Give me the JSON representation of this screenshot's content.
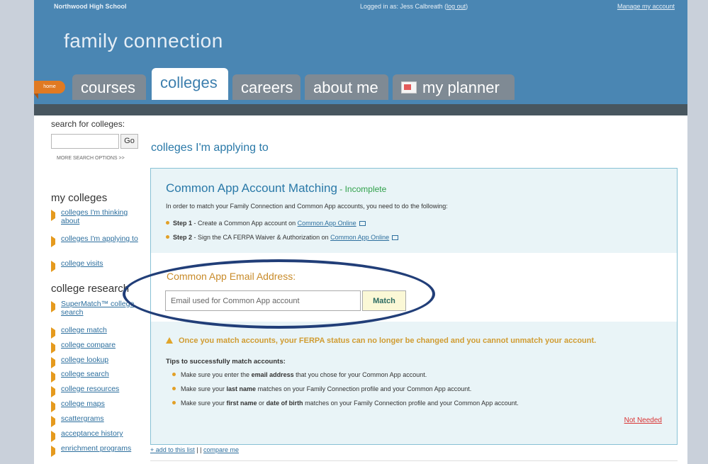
{
  "header": {
    "school": "Northwood High School",
    "logged_in": "Logged in as: Jess Calbreath",
    "logout": "log out",
    "manage": "Manage my account",
    "brand": "family connection"
  },
  "tabs": {
    "home": "home",
    "items": [
      "courses",
      "colleges",
      "careers",
      "about me",
      "my planner"
    ]
  },
  "sidebar": {
    "search_label": "search for colleges:",
    "go_label": "Go",
    "more_options": "MORE SEARCH OPTIONS >>",
    "my_colleges_heading": "my colleges",
    "my_colleges": [
      "colleges I'm thinking about",
      "colleges I'm applying to",
      "college visits"
    ],
    "college_research_heading": "college research",
    "college_research": [
      "SuperMatch™ college search",
      "college match",
      "college compare",
      "college lookup",
      "college search",
      "college resources",
      "college maps",
      "scattergrams",
      "acceptance history",
      "enrichment programs"
    ]
  },
  "main": {
    "title": "colleges I'm applying to",
    "panel_heading": "Common App Account Matching",
    "panel_status": " - Incomplete",
    "panel_text": "In order to match your Family Connection and Common App accounts, you need to do the following:",
    "steps": [
      {
        "label": "Step 1",
        "text": " - Create a Common App account on ",
        "link": "Common App Online"
      },
      {
        "label": "Step 2",
        "text": " - Sign the CA FERPA Waiver & Authorization on ",
        "link": "Common App Online"
      }
    ],
    "email_label": "Common App Email Address:",
    "email_placeholder": "Email used for Common App account",
    "match_label": "Match",
    "warning": "Once you match accounts, your FERPA status can no longer be changed and you cannot unmatch your account.",
    "tips_heading": "Tips to successfully match accounts:",
    "tips": [
      {
        "pre": "Make sure you enter the ",
        "bold": "email address",
        "post": " that you chose for your Common App account."
      },
      {
        "pre": "Make sure your ",
        "bold": "last name",
        "post": " matches on your Family Connection profile and your Common App account."
      },
      {
        "pre": "Make sure your ",
        "bold": "first name",
        "mid": " or ",
        "bold2": "date of birth",
        "post": " matches on your Family Connection profile and your Common App account."
      }
    ],
    "not_needed": "Not Needed",
    "add_to_list": "+ add to this list",
    "separator": " | | ",
    "compare_me": "compare me"
  },
  "colors": {
    "header_blue": "#4a86b3",
    "accent_orange": "#e07a22",
    "panel_bg": "#e9f4f7",
    "annotation_ellipse": "#213e78"
  }
}
